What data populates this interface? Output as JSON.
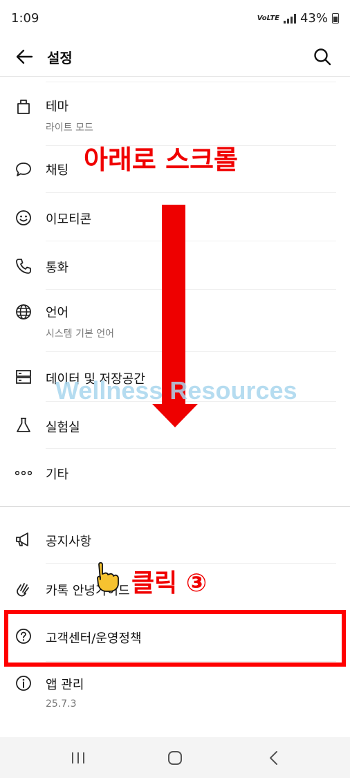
{
  "status": {
    "time": "1:09",
    "network_badge": "VoLTE",
    "battery": "43%"
  },
  "header": {
    "title": "설정",
    "back_icon": "arrow-left-icon",
    "search_icon": "search-icon"
  },
  "items": [
    {
      "label": "테마",
      "sub": "라이트 모드",
      "icon": "theme-brush-icon"
    },
    {
      "label": "채팅",
      "sub": "",
      "icon": "chat-bubble-icon"
    },
    {
      "label": "이모티콘",
      "sub": "",
      "icon": "smiley-icon"
    },
    {
      "label": "통화",
      "sub": "",
      "icon": "phone-icon"
    },
    {
      "label": "언어",
      "sub": "시스템 기본 언어",
      "icon": "globe-icon"
    },
    {
      "label": "데이터 및 저장공간",
      "sub": "",
      "icon": "storage-icon"
    },
    {
      "label": "실험실",
      "sub": "",
      "icon": "flask-icon"
    },
    {
      "label": "기타",
      "sub": "",
      "icon": "more-dots-icon"
    },
    {
      "label": "공지사항",
      "sub": "",
      "icon": "megaphone-icon"
    },
    {
      "label": "카톡 안녕가이드",
      "sub": "",
      "icon": "waving-hand-icon"
    },
    {
      "label": "고객센터/운영정책",
      "sub": "",
      "icon": "help-circle-icon"
    },
    {
      "label": "앱 관리",
      "sub": "25.7.3",
      "icon": "info-circle-icon"
    }
  ],
  "annotations": {
    "scroll_text": "아래로 스크롤",
    "click_text": "클릭 ③",
    "watermark": "Wellness Resources",
    "color": "#f00000"
  },
  "nav": {
    "recents_icon": "recents-icon",
    "home_icon": "home-icon",
    "back_icon": "back-chevron-icon"
  }
}
